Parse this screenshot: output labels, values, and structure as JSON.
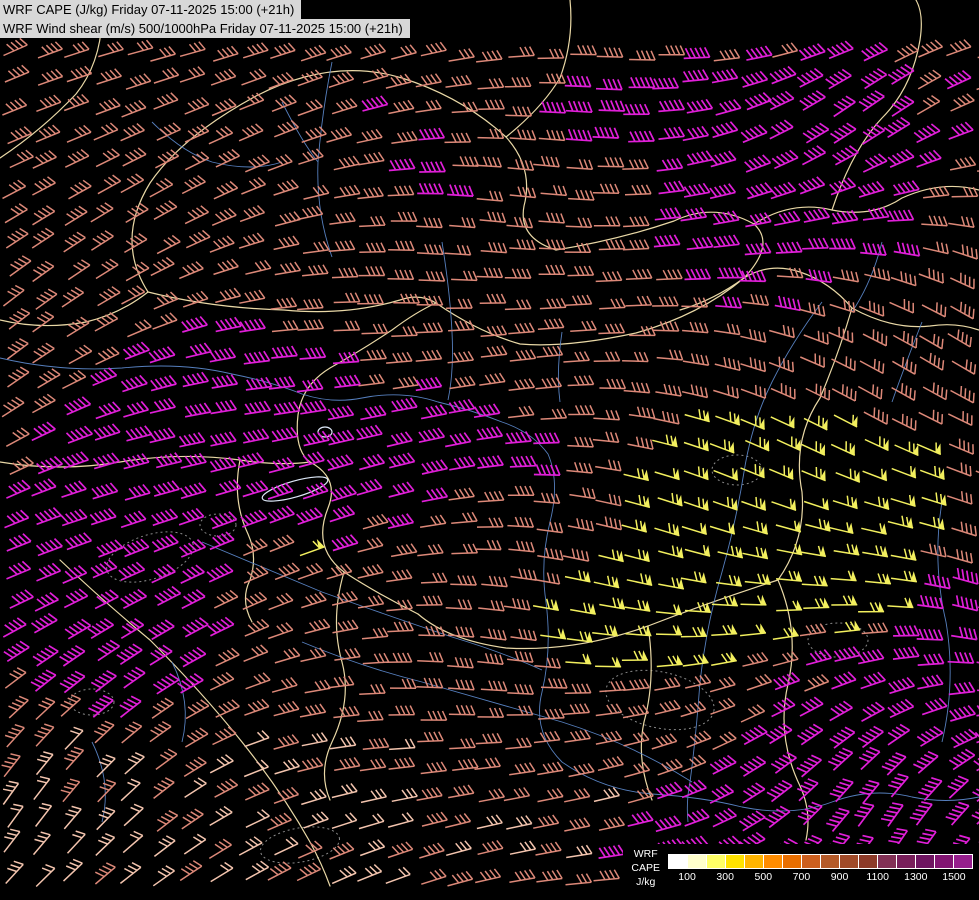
{
  "titles": {
    "line1": "WRF CAPE (J/kg) Friday 07-11-2025 15:00 (+21h)",
    "line2": "WRF Wind shear (m/s) 500/1000hPa Friday 07-11-2025 15:00 (+21h)"
  },
  "legend": {
    "label_lines": [
      "WRF",
      "CAPE",
      "J/kg"
    ],
    "ticks": [
      "100",
      "300",
      "500",
      "700",
      "900",
      "1100",
      "1300",
      "1500"
    ],
    "colors": [
      "#ffffff",
      "#ffffcc",
      "#ffff66",
      "#ffe200",
      "#ffb400",
      "#ff8c00",
      "#e86e00",
      "#cc5f1e",
      "#b45a28",
      "#a04a28",
      "#8c3a28",
      "#823055",
      "#781e5a",
      "#6e1460",
      "#821472",
      "#961e8c"
    ]
  },
  "map": {
    "background_color": "#000000",
    "border_color": "#e9d8a6",
    "river_color": "#5b86c8",
    "contour_color": "#8a8a8a",
    "lake_color": "#dde8f8",
    "barb_colors": {
      "low": "#dc8878",
      "mid": "#e01fd8",
      "high": "#f2ef5e",
      "pale": "#f3c4ae"
    }
  }
}
